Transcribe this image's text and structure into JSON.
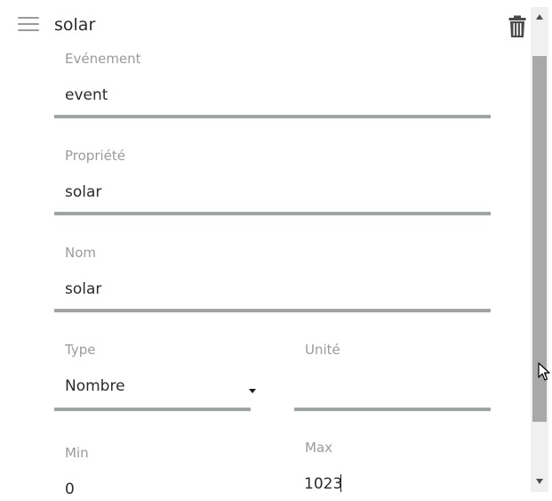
{
  "header": {
    "title": "solar"
  },
  "form": {
    "event": {
      "label": "Evénement",
      "value": "event"
    },
    "property": {
      "label": "Propriété",
      "value": "solar"
    },
    "name": {
      "label": "Nom",
      "value": "solar"
    },
    "type": {
      "label": "Type",
      "value": "Nombre"
    },
    "unit": {
      "label": "Unité",
      "value": ""
    },
    "min": {
      "label": "Min",
      "value": "0"
    },
    "max": {
      "label": "Max",
      "value": "1023"
    }
  },
  "colors": {
    "underline": "#9ea5a3",
    "label": "#9b9b9b",
    "text": "#2b2b2b",
    "scroll_thumb": "#a8a8a8"
  },
  "icons": {
    "menu": "hamburger-menu-icon",
    "delete": "trash-icon",
    "select": "dropdown-arrow-icon",
    "pointer": "mouse-pointer-icon"
  }
}
